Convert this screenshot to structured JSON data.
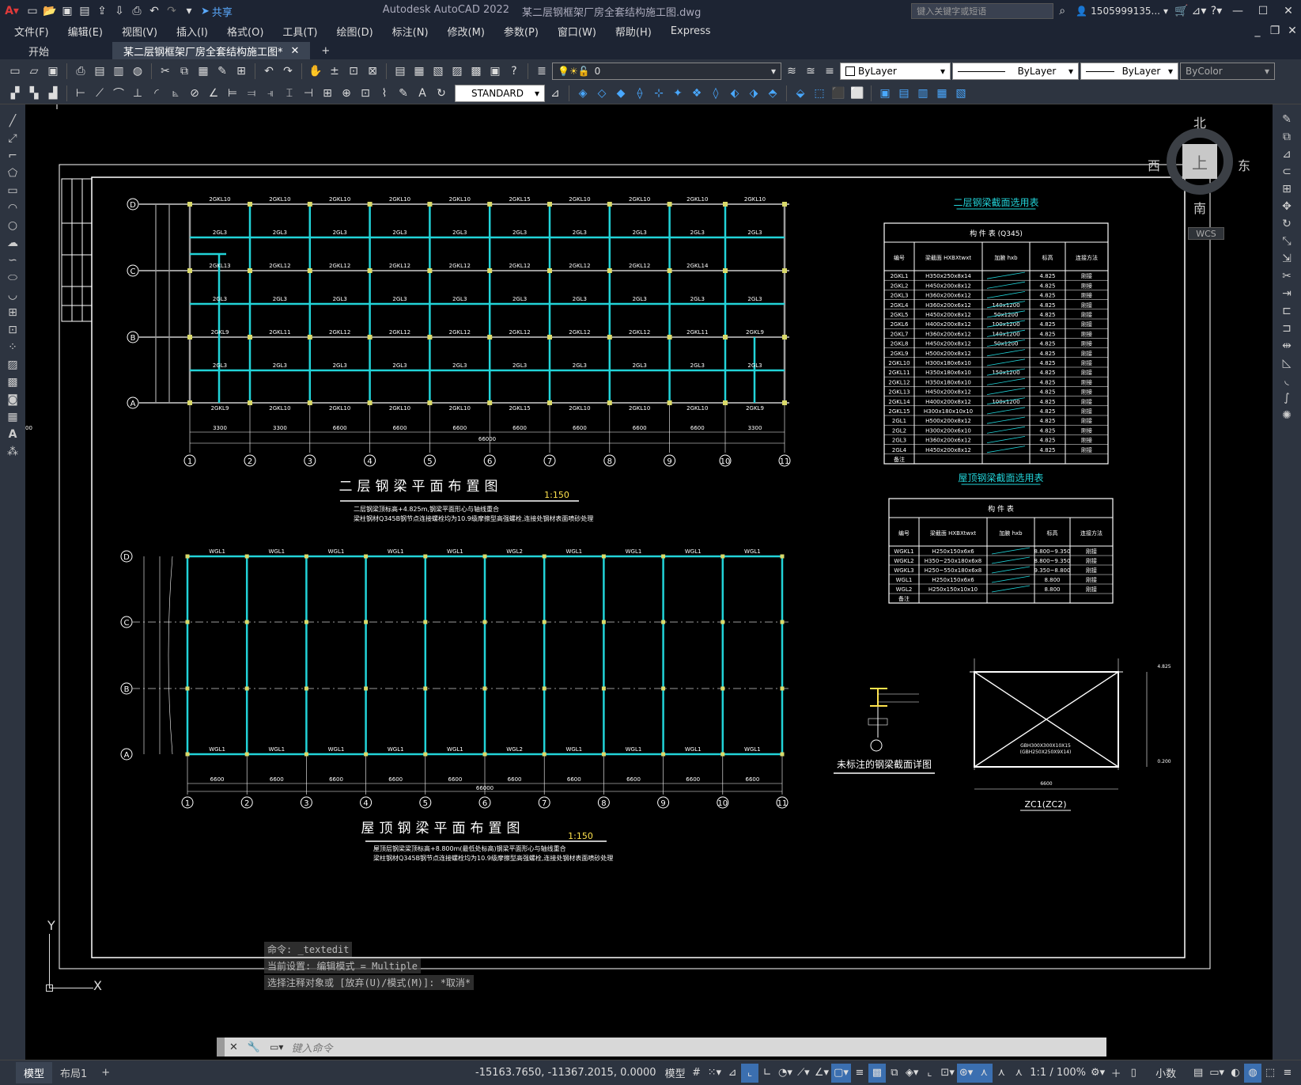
{
  "title": {
    "app": "Autodesk AutoCAD 2022",
    "file": "某二层钢框架厂房全套结构施工图.dwg",
    "search_placeholder": "键入关键字或短语",
    "user": "1505999135...",
    "share": "共享"
  },
  "menu": [
    "文件(F)",
    "编辑(E)",
    "视图(V)",
    "插入(I)",
    "格式(O)",
    "工具(T)",
    "绘图(D)",
    "标注(N)",
    "修改(M)",
    "参数(P)",
    "窗口(W)",
    "帮助(H)",
    "Express"
  ],
  "tabs": {
    "start": "开始",
    "doc": "某二层钢框架厂房全套结构施工图*",
    "add": "+"
  },
  "toolbar": {
    "layer": "0",
    "color": "ByLayer",
    "linetype": "ByLayer",
    "lineweight": "ByLayer",
    "plotstyle": "ByColor",
    "dimstyle": "STANDARD"
  },
  "viewcube": {
    "north": "北",
    "south": "南",
    "east": "东",
    "west": "西",
    "top": "上",
    "wcs": "WCS"
  },
  "ucs": {
    "x": "X",
    "y": "Y"
  },
  "command": {
    "history": [
      "命令: _textedit",
      "当前设置: 编辑模式 = Multiple",
      "选择注释对象或 [放弃(U)/模式(M)]: *取消*"
    ],
    "placeholder": "键入命令"
  },
  "status": {
    "model_tab": "模型",
    "layout_tab": "布局1",
    "add": "+",
    "coords": "-15163.7650, -11367.2015, 0.0000",
    "model": "模型",
    "scale": "1:1 / 100%",
    "units": "小数"
  },
  "drawing": {
    "plan1": {
      "title": "二层钢梁平面布置图",
      "scale": "1:150",
      "note1": "二层钢梁顶标高+4.825m,钢梁平面形心与轴线重合",
      "note2": "梁柱钢材Q345B钢节点连接螺栓均为10.9级摩擦型高强螺栓,连接处钢材表面喷砂处理",
      "axes_h": [
        "D",
        "C",
        "B",
        "A"
      ],
      "axes_v": [
        "1",
        "2",
        "3",
        "4",
        "5",
        "6",
        "7",
        "8",
        "9",
        "10",
        "11"
      ],
      "dims_bottom": [
        "3300",
        "3300",
        "6600",
        "6600",
        "6600",
        "6600",
        "6600",
        "6600",
        "6600",
        "3300",
        "3300"
      ],
      "total": "66000",
      "top_beams": [
        "2GKL10",
        "2GKL10",
        "2GKL10",
        "2GKL10",
        "2GKL10",
        "2GKL15",
        "2GKL10",
        "2GKL10",
        "2GKL10",
        "2GKL10"
      ],
      "bottom_beams": [
        "2GKL9",
        "2GKL10",
        "2GKL10",
        "2GKL10",
        "2GKL10",
        "2GKL15",
        "2GKL10",
        "2GKL10",
        "2GKL10",
        "2GKL9"
      ],
      "mid_beams": [
        "2GKL13",
        "2GKL12",
        "2GKL12",
        "2GKL12",
        "2GKL12",
        "2GKL12",
        "2GKL12",
        "2GKL12",
        "2GKL14"
      ],
      "b_beams": [
        "2GKL9",
        "2GKL11",
        "2GKL12",
        "2GKL12",
        "2GKL12",
        "2GKL12",
        "2GKL12",
        "2GKL12",
        "2GKL11",
        "2GKL9"
      ],
      "sec_beam": "2GL3"
    },
    "plan2": {
      "title": "屋顶钢梁平面布置图",
      "scale": "1:150",
      "note1": "屋顶层钢梁梁顶标高+8.800m(最低处标高)钢梁平面形心与轴线重合",
      "note2": "梁柱钢材Q345B钢节点连接螺栓均为10.9级摩擦型高强螺栓,连接处钢材表面喷砂处理",
      "top_beams": [
        "WGL1",
        "WGL1",
        "WGL1",
        "WGL1",
        "WGL1",
        "WGL2",
        "WGL1",
        "WGL1",
        "WGL1",
        "WGL1"
      ],
      "dims_bottom": [
        "6600",
        "6600",
        "6600",
        "6600",
        "6600",
        "6600",
        "6600",
        "6600",
        "6600",
        "6600"
      ],
      "total": "66000"
    },
    "table1": {
      "title": "二层钢梁截面选用表",
      "caption": "构 件 表   (Q345)",
      "headers": [
        "编号",
        "梁截面 HXBXtwxt",
        "加腋 hxb",
        "标高",
        "连接方法"
      ],
      "rows": [
        [
          "2GKL1",
          "H350x250x8x14",
          "",
          "4.825",
          "刚接"
        ],
        [
          "2GKL2",
          "H450x200x8x12",
          "",
          "4.825",
          "刚接"
        ],
        [
          "2GKL3",
          "H360x200x6x12",
          "",
          "4.825",
          "刚接"
        ],
        [
          "2GKL4",
          "H360x200x6x12",
          "140x1200",
          "4.825",
          "刚接"
        ],
        [
          "2GKL5",
          "H450x200x8x12",
          "50x1200",
          "4.825",
          "刚接"
        ],
        [
          "2GKL6",
          "H400x200x8x12",
          "100x1200",
          "4.825",
          "刚接"
        ],
        [
          "2GKL7",
          "H360x200x6x12",
          "140x1200",
          "4.825",
          "刚接"
        ],
        [
          "2GKL8",
          "H450x200x8x12",
          "50x1200",
          "4.825",
          "刚接"
        ],
        [
          "2GKL9",
          "H500x200x8x12",
          "",
          "4.825",
          "刚接"
        ],
        [
          "2GKL10",
          "H300x180x6x10",
          "",
          "4.825",
          "刚接"
        ],
        [
          "2GKL11",
          "H350x180x6x10",
          "150x1200",
          "4.825",
          "刚接"
        ],
        [
          "2GKL12",
          "H350x180x6x10",
          "",
          "4.825",
          "刚接"
        ],
        [
          "2GKL13",
          "H450x200x8x12",
          "",
          "4.825",
          "刚接"
        ],
        [
          "2GKL14",
          "H400x200x8x12",
          "100x1200",
          "4.825",
          "刚接"
        ],
        [
          "2GKL15",
          "H300x180x10x10",
          "",
          "4.825",
          "刚接"
        ],
        [
          "2GL1",
          "H500x200x8x12",
          "",
          "4.825",
          "刚接"
        ],
        [
          "2GL2",
          "H300x200x6x10",
          "",
          "4.825",
          "刚接"
        ],
        [
          "2GL3",
          "H360x200x6x12",
          "",
          "4.825",
          "刚接"
        ],
        [
          "2GL4",
          "H450x200x8x12",
          "",
          "4.825",
          "刚接"
        ],
        [
          "备注",
          "",
          "",
          "",
          ""
        ]
      ]
    },
    "table2": {
      "title": "屋顶钢梁截面选用表",
      "caption": "构 件 表",
      "headers": [
        "编号",
        "梁截面 HXBXtwxt",
        "加腋 hxb",
        "标高",
        "连接方法"
      ],
      "rows": [
        [
          "WGKL1",
          "H250x150x6x6",
          "",
          "8.800~9.350",
          "刚接"
        ],
        [
          "WGKL2",
          "H350~250x180x6x8",
          "",
          "8.800~9.350",
          "刚接"
        ],
        [
          "WGKL3",
          "H250~550x180x6x8",
          "",
          "9.350~8.800",
          "刚接"
        ],
        [
          "WGL1",
          "H250x150x6x6",
          "",
          "8.800",
          "刚接"
        ],
        [
          "WGL2",
          "H250x150x10x10",
          "",
          "8.800",
          "刚接"
        ],
        [
          "备注",
          "",
          "",
          "",
          ""
        ]
      ]
    },
    "detail1": {
      "caption": "未标注的钢梁截面详图"
    },
    "detail2": {
      "caption": "ZC1(ZC2)",
      "label1": "GBH300X300X10X15",
      "label2": "(GBH250X250X9X14)",
      "dim": "6600",
      "elev_top": "4.825",
      "elev_bot": "0.200"
    }
  }
}
